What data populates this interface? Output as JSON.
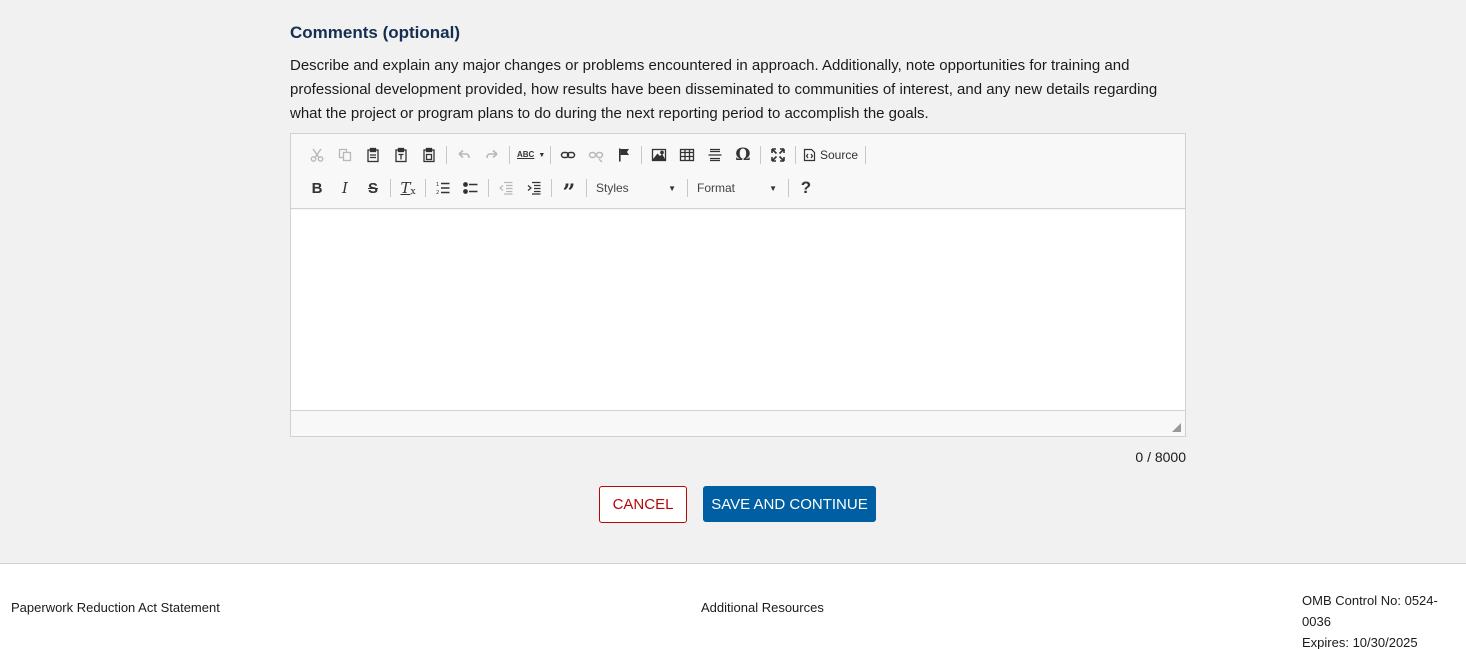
{
  "comments": {
    "heading": "Comments (optional)",
    "description": "Describe and explain any major changes or problems encountered in approach. Additionally, note opportunities for training and professional development provided, how results have been disseminated to communities of interest, and any new details regarding what the project or program plans to do during the next reporting period to accomplish the goals.",
    "counter": "0 / 8000"
  },
  "editor": {
    "source_label": "Source",
    "styles_label": "Styles",
    "format_label": "Format",
    "spellcheck_label": "ABC",
    "special_char": "Ω",
    "help_label": "?"
  },
  "actions": {
    "cancel_label": "CANCEL",
    "save_label": "SAVE AND CONTINUE"
  },
  "footer": {
    "paperwork": "Paperwork Reduction Act Statement",
    "resources": "Additional Resources",
    "omb_control": "OMB Control No: 0524-0036",
    "expires": "Expires: 10/30/2025"
  },
  "colors": {
    "heading": "#162e51",
    "primary": "#005ea2",
    "cancel": "#b50909"
  }
}
